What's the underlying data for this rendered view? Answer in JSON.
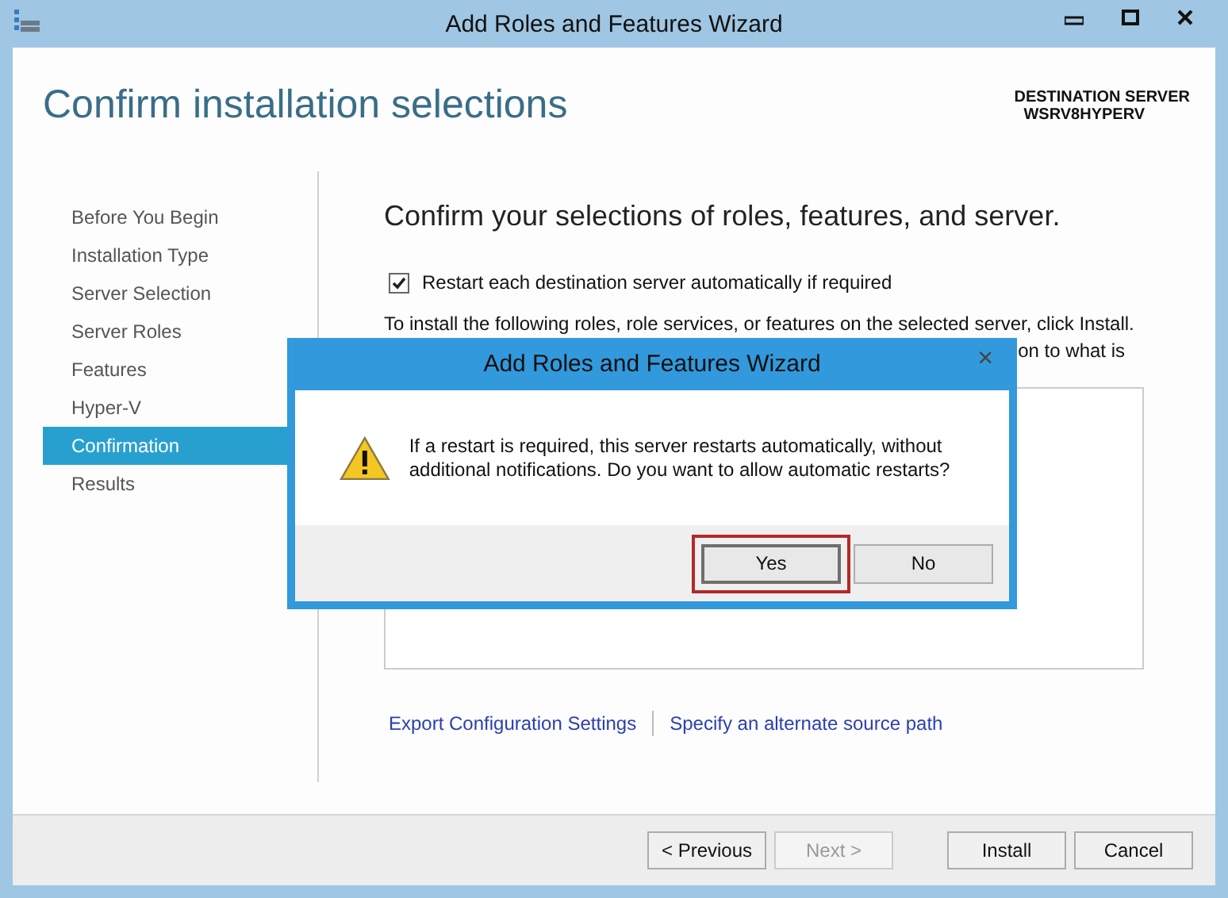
{
  "window": {
    "title": "Add Roles and Features Wizard",
    "page_title": "Confirm installation selections",
    "destination_label": "DESTINATION SERVER",
    "destination_server": "WSRV8HYPERV"
  },
  "sidebar": {
    "items": [
      {
        "label": "Before You Begin",
        "selected": false
      },
      {
        "label": "Installation Type",
        "selected": false
      },
      {
        "label": "Server Selection",
        "selected": false
      },
      {
        "label": "Server Roles",
        "selected": false
      },
      {
        "label": "Features",
        "selected": false
      },
      {
        "label": "Hyper-V",
        "selected": false
      },
      {
        "label": "Confirmation",
        "selected": true
      },
      {
        "label": "Results",
        "selected": false
      }
    ]
  },
  "main": {
    "heading": "Confirm your selections of roles, features, and server.",
    "restart_checkbox": {
      "label": "Restart each destination server automatically if required",
      "checked": true
    },
    "instructions_line_1": "To install the following roles, role services, or features on the selected server, click Install.",
    "instructions_line_2_visible": "on to what is",
    "links": [
      "Export Configuration Settings",
      "Specify an alternate source path"
    ]
  },
  "footer": {
    "buttons": [
      {
        "label": "< Previous",
        "disabled": false
      },
      {
        "label": "Next >",
        "disabled": true
      },
      {
        "label": "Install",
        "disabled": false
      },
      {
        "label": "Cancel",
        "disabled": false
      }
    ]
  },
  "dialog": {
    "title": "Add Roles and Features Wizard",
    "close": "×",
    "message": "If a restart is required, this server restarts automatically, without additional notifications. Do you want to allow automatic restarts?",
    "buttons": [
      {
        "label": "Yes",
        "focused": true
      },
      {
        "label": "No",
        "focused": false
      }
    ]
  }
}
